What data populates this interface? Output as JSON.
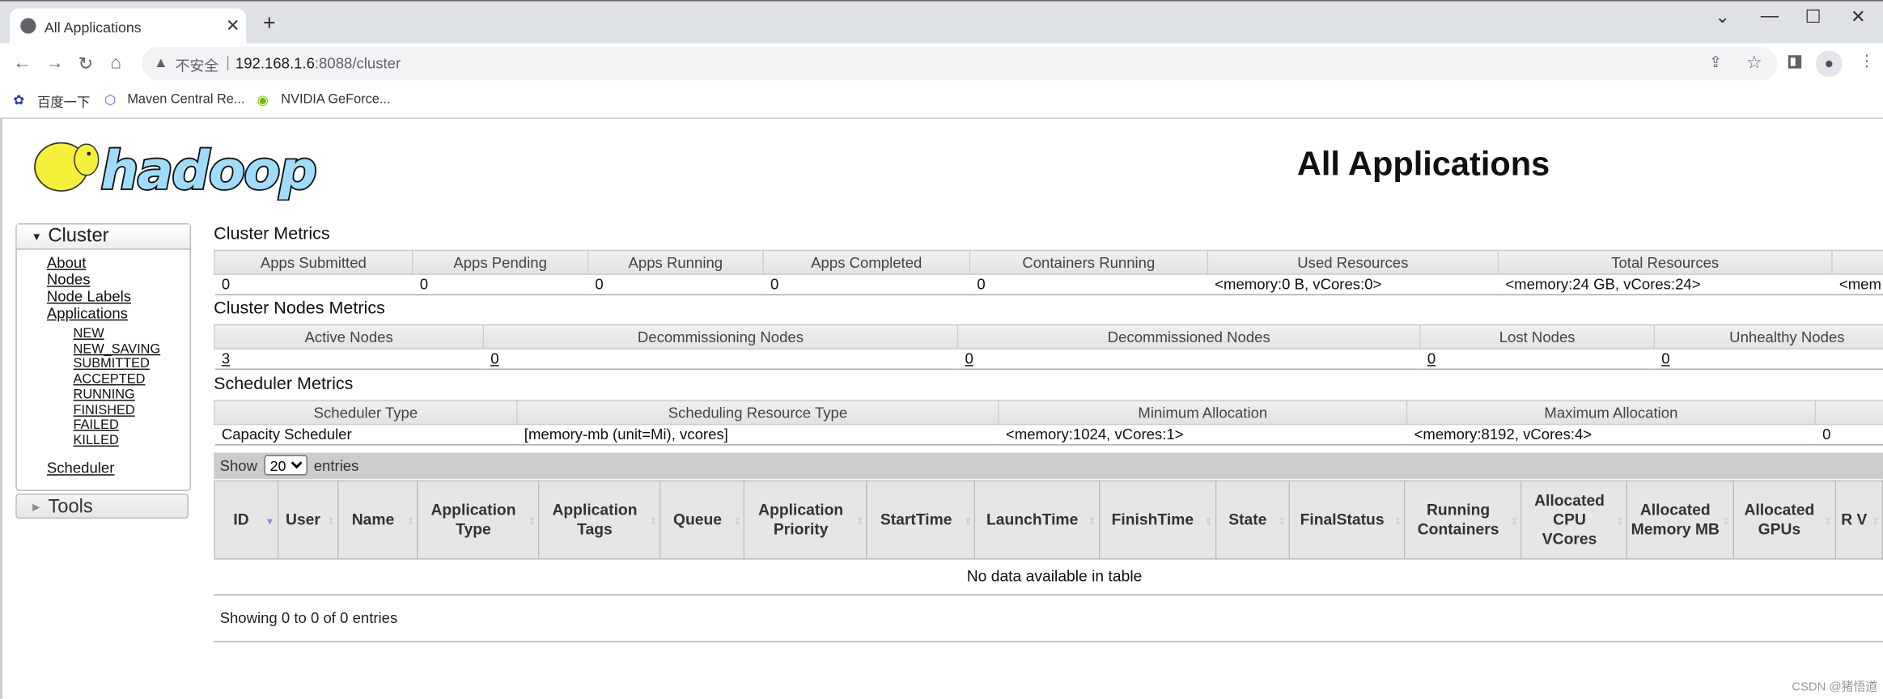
{
  "browser": {
    "tab_title": "All Applications",
    "new_tab": "+",
    "url_warning": "不安全",
    "url_host": "192.168.1.6",
    "url_rest": ":8088/cluster",
    "bookmarks": [
      "百度一下",
      "Maven Central Re...",
      "NVIDIA GeForce..."
    ]
  },
  "page": {
    "title": "All Applications",
    "logo_text": "hadoop"
  },
  "sidebar": {
    "cluster": "Cluster",
    "links": [
      "About",
      "Nodes",
      "Node Labels",
      "Applications"
    ],
    "states": [
      "NEW",
      "NEW_SAVING",
      "SUBMITTED",
      "ACCEPTED",
      "RUNNING",
      "FINISHED",
      "FAILED",
      "KILLED"
    ],
    "scheduler": "Scheduler",
    "tools": "Tools"
  },
  "cluster_metrics": {
    "heading": "Cluster Metrics",
    "headers": [
      "Apps Submitted",
      "Apps Pending",
      "Apps Running",
      "Apps Completed",
      "Containers Running",
      "Used Resources",
      "Total Resources",
      ""
    ],
    "values": [
      "0",
      "0",
      "0",
      "0",
      "0",
      "<memory:0 B, vCores:0>",
      "<memory:24 GB, vCores:24>",
      "<mem"
    ]
  },
  "nodes_metrics": {
    "heading": "Cluster Nodes Metrics",
    "headers": [
      "Active Nodes",
      "Decommissioning Nodes",
      "Decommissioned Nodes",
      "Lost Nodes",
      "Unhealthy Nodes"
    ],
    "values": [
      "3",
      "0",
      "0",
      "0",
      "0"
    ]
  },
  "scheduler_metrics": {
    "heading": "Scheduler Metrics",
    "headers": [
      "Scheduler Type",
      "Scheduling Resource Type",
      "Minimum Allocation",
      "Maximum Allocation",
      ""
    ],
    "values": [
      "Capacity Scheduler",
      "[memory-mb (unit=Mi), vcores]",
      "<memory:1024, vCores:1>",
      "<memory:8192, vCores:4>",
      "0"
    ]
  },
  "apps": {
    "show": "Show",
    "page_size": "20",
    "entries": "entries",
    "columns": [
      "ID",
      "User",
      "Name",
      "Application Type",
      "Application Tags",
      "Queue",
      "Application Priority",
      "StartTime",
      "LaunchTime",
      "FinishTime",
      "State",
      "FinalStatus",
      "Running Containers",
      "Allocated CPU VCores",
      "Allocated Memory MB",
      "Allocated GPUs",
      "R V"
    ],
    "empty": "No data available in table",
    "footer": "Showing 0 to 0 of 0 entries"
  },
  "watermark": "CSDN @猪悟道"
}
